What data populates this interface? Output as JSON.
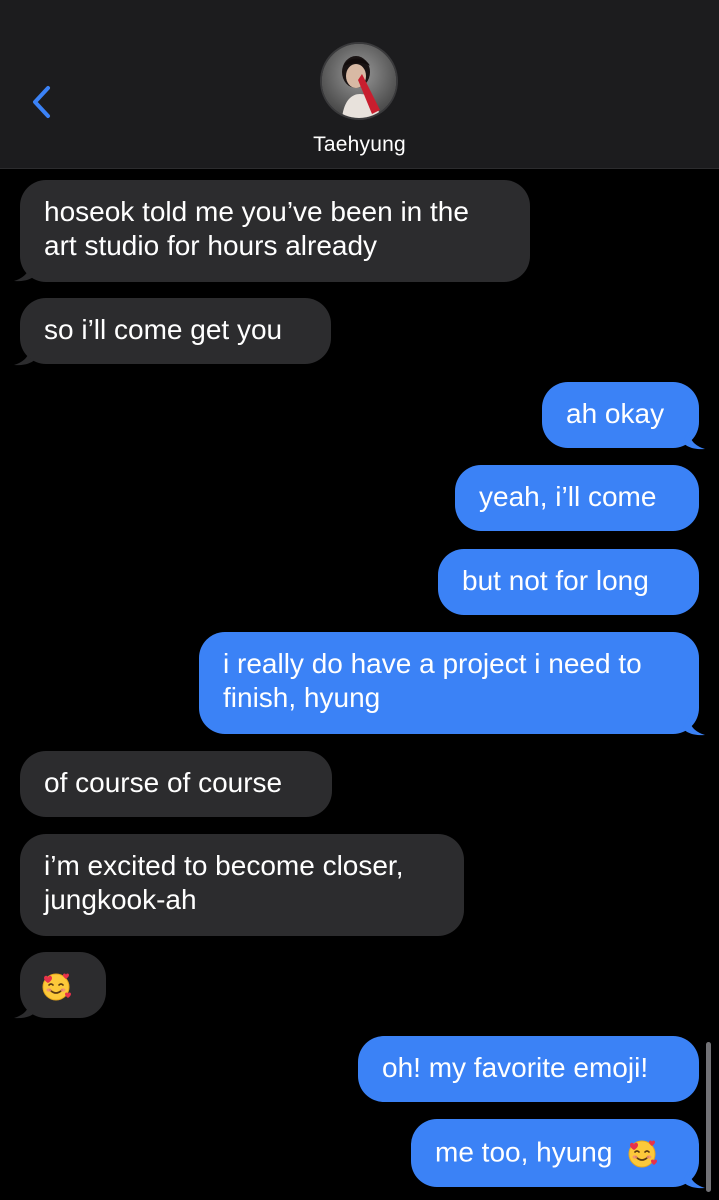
{
  "header": {
    "contact_name": "Taehyung",
    "accent_color": "#3b82f6"
  },
  "messages": [
    {
      "dir": "in",
      "text": "hoseok told me you’ve been in the\nart studio for hours already"
    },
    {
      "dir": "in",
      "text": "so i’ll come get you"
    },
    {
      "dir": "out",
      "text": "ah okay"
    },
    {
      "dir": "out",
      "text": "yeah, i’ll come"
    },
    {
      "dir": "out",
      "text": "but not for long"
    },
    {
      "dir": "out",
      "text": "i really do have a project i need to\nfinish, hyung"
    },
    {
      "dir": "in",
      "text": "of course of course"
    },
    {
      "dir": "in",
      "text": "i’m excited to become closer,\njungkook-ah"
    },
    {
      "dir": "in",
      "text": "",
      "emoji": "smiling-face-with-hearts"
    },
    {
      "dir": "out",
      "text": "oh! my favorite emoji!"
    },
    {
      "dir": "out",
      "text": "me too, hyung",
      "emoji": "smiling-face-with-hearts"
    }
  ]
}
